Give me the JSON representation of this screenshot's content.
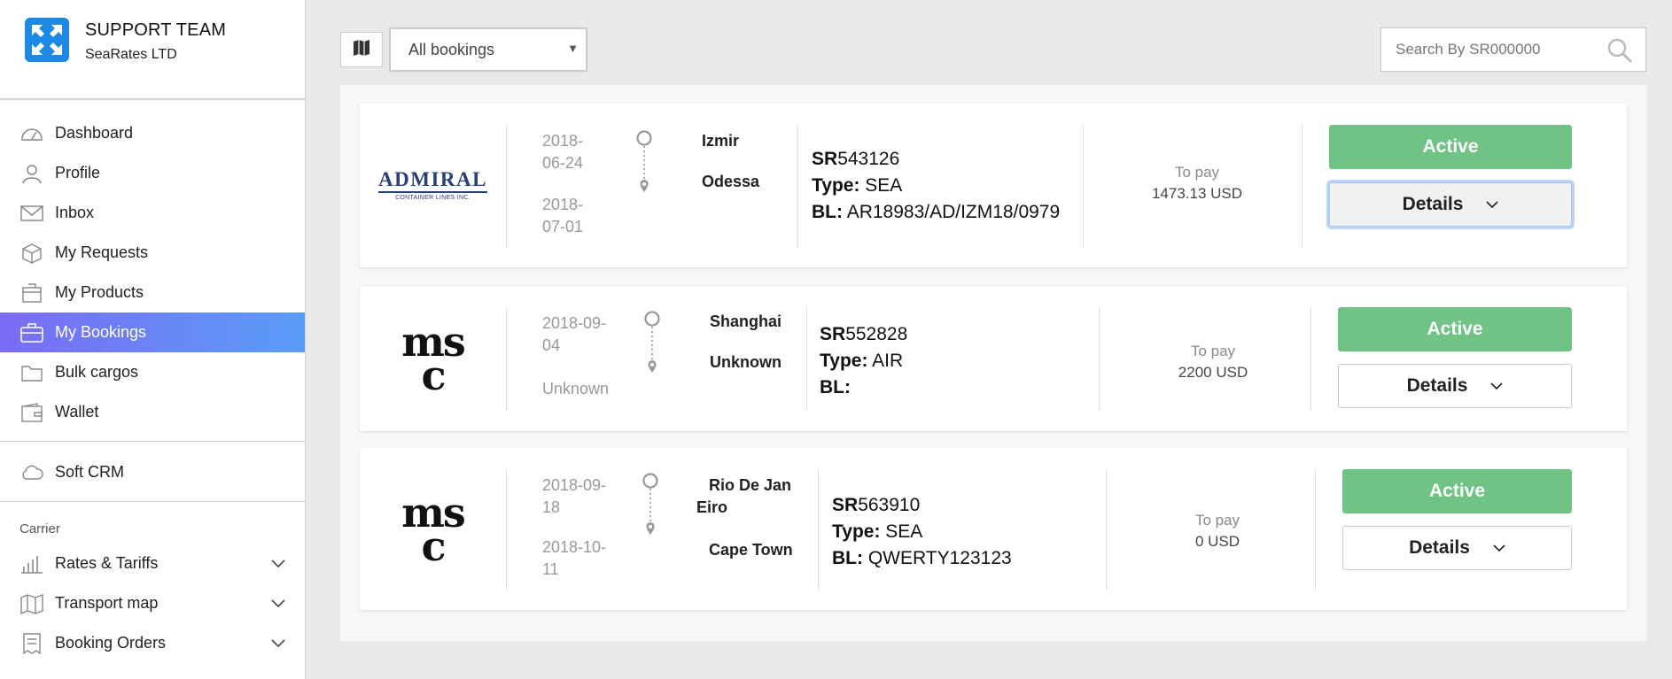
{
  "brand": {
    "team": "SUPPORT TEAM",
    "company": "SeaRates LTD"
  },
  "nav": [
    {
      "label": "Dashboard",
      "icon": "dashboard-icon"
    },
    {
      "label": "Profile",
      "icon": "user-icon"
    },
    {
      "label": "Inbox",
      "icon": "mail-icon"
    },
    {
      "label": "My Requests",
      "icon": "box-icon"
    },
    {
      "label": "My Products",
      "icon": "package-icon"
    },
    {
      "label": "My Bookings",
      "icon": "briefcase-icon",
      "active": true
    },
    {
      "label": "Bulk cargos",
      "icon": "folder-icon"
    },
    {
      "label": "Wallet",
      "icon": "wallet-icon"
    }
  ],
  "soft_crm": {
    "label": "Soft CRM",
    "icon": "cloud-icon"
  },
  "carrier": {
    "title": "Carrier",
    "items": [
      {
        "label": "Rates & Tariffs",
        "icon": "bar-chart-icon"
      },
      {
        "label": "Transport map",
        "icon": "map-icon"
      },
      {
        "label": "Booking Orders",
        "icon": "receipt-icon"
      }
    ]
  },
  "toolbar": {
    "filter_value": "All bookings",
    "search_placeholder": "Search By SR000000"
  },
  "bookings": [
    {
      "carrier": "ADMIRAL",
      "carrier_sub": "CONTAINER LINES INC.",
      "date_from_1": "2018-",
      "date_from_2": "06-24",
      "date_to_1": "2018-",
      "date_to_2": "07-01",
      "origin": "Izmir",
      "destination": "Odessa",
      "sr_prefix": "SR",
      "sr_number": "543126",
      "type_label": "Type:",
      "type": "SEA",
      "bl_label": "BL:",
      "bl": "AR18983/AD/IZM18/0979",
      "pay_label": "To pay",
      "amount": "1473.13 USD",
      "status": "Active",
      "details": "Details"
    },
    {
      "carrier": "msc",
      "date_from_1": "2018-09-",
      "date_from_2": "04",
      "date_to_1": "Unknown",
      "date_to_2": "",
      "origin": "Shanghai",
      "destination": "Unknown",
      "sr_prefix": "SR",
      "sr_number": "552828",
      "type_label": "Type:",
      "type": "AIR",
      "bl_label": "BL:",
      "bl": "",
      "pay_label": "To pay",
      "amount": "2200 USD",
      "status": "Active",
      "details": "Details"
    },
    {
      "carrier": "msc",
      "date_from_1": "2018-09-",
      "date_from_2": "18",
      "date_to_1": "2018-10-",
      "date_to_2": "11",
      "origin_1": "Rio De Jan",
      "origin_2": "Eiro",
      "destination": "Cape Town",
      "sr_prefix": "SR",
      "sr_number": "563910",
      "type_label": "Type:",
      "type": "SEA",
      "bl_label": "BL:",
      "bl": "QWERTY123123",
      "pay_label": "To pay",
      "amount": "0 USD",
      "status": "Active",
      "details": "Details"
    }
  ],
  "colors": {
    "active_green": "#6fc385",
    "nav_active_from": "#7a6cf5",
    "nav_active_to": "#5a9cf8",
    "brand_blue": "#1e88e5"
  }
}
